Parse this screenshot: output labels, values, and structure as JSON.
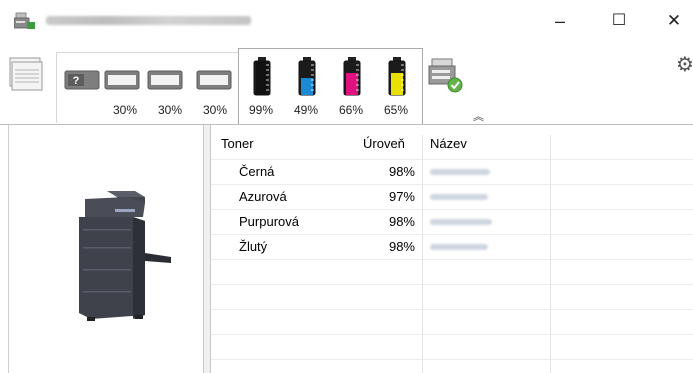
{
  "window": {
    "title": "",
    "minimize_glyph": "–",
    "maximize_glyph": "☐",
    "close_glyph": "✕"
  },
  "toolbar": {
    "trays": [
      {
        "name": "unknown-tray",
        "level": ""
      },
      {
        "name": "tray-1",
        "level": "30%"
      },
      {
        "name": "tray-2",
        "level": "30%"
      },
      {
        "name": "tray-3",
        "level": "30%"
      }
    ],
    "toners": [
      {
        "name": "black",
        "color": "#111111",
        "level_text": "99%",
        "fill": 0.99
      },
      {
        "name": "cyan",
        "color": "#1a8ad4",
        "level_text": "49%",
        "fill": 0.49
      },
      {
        "name": "magenta",
        "color": "#e0127f",
        "level_text": "66%",
        "fill": 0.66
      },
      {
        "name": "yellow",
        "color": "#e8e000",
        "level_text": "65%",
        "fill": 0.65
      }
    ],
    "collapse_glyph": "︽",
    "settings_glyph": "⚙"
  },
  "table": {
    "headers": {
      "toner": "Toner",
      "level": "Úroveň",
      "name": "Název"
    },
    "rows": [
      {
        "toner": "Černá",
        "level": "98%"
      },
      {
        "toner": "Azurová",
        "level": "97%"
      },
      {
        "toner": "Purpurová",
        "level": "98%"
      },
      {
        "toner": "Žlutý",
        "level": "98%"
      }
    ]
  }
}
